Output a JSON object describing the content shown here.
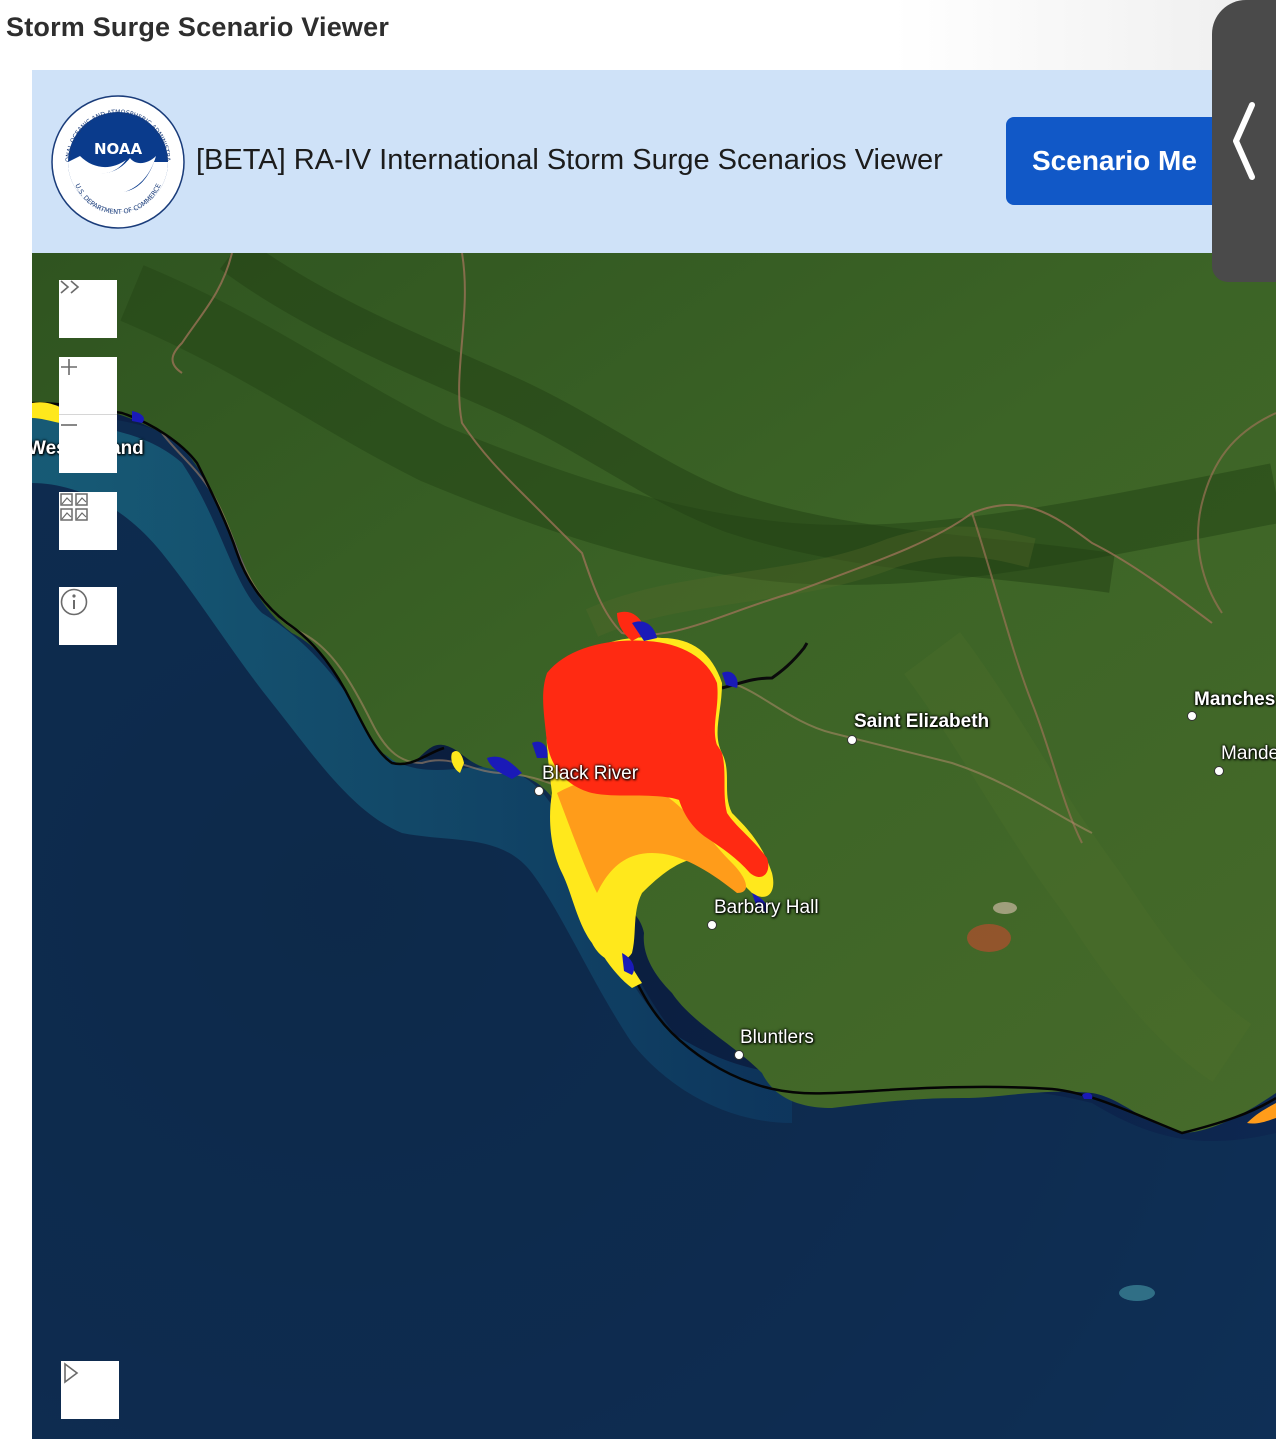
{
  "page": {
    "title": "Storm Surge Scenario Viewer"
  },
  "banner": {
    "logo": {
      "icon": "noaa-logo-icon",
      "center_text": "NOAA",
      "ring_text_top": "NATIONAL OCEANIC AND ATMOSPHERIC ADMINISTRATION",
      "ring_text_bottom": "U.S. DEPARTMENT OF COMMERCE"
    },
    "title": "[BETA] RA-IV International Storm Surge Scenarios Viewer",
    "scenario_button_label": "Scenario Me"
  },
  "map": {
    "controls": {
      "expand": {
        "icon": "double-chevron-right-icon",
        "label": "››"
      },
      "zoom_in": {
        "icon": "plus-icon",
        "label": "+"
      },
      "zoom_out": {
        "icon": "minus-icon",
        "label": "−"
      },
      "basemap": {
        "icon": "basemap-gallery-icon"
      },
      "info": {
        "icon": "info-icon"
      },
      "play": {
        "icon": "play-triangle-icon"
      }
    },
    "labels": {
      "westmoreland": "Wes  land",
      "saint_elizabeth": "Saint Elizabeth",
      "black_river": "Black River",
      "barbary_hall": "Barbary Hall",
      "bluntlers": "Bluntlers",
      "manchester": "Manches",
      "mandeville": "Mande"
    }
  },
  "side_panel": {
    "toggle_icon": "chevron-left-icon",
    "toggle_glyph": "❮"
  },
  "colors": {
    "banner_bg": "#cfe2f8",
    "button_blue": "#1158c7",
    "surge_high": "#ff2a12",
    "surge_mid": "#ff9c1a",
    "surge_low": "#ffe81c",
    "surge_shallow": "#1a1ab8",
    "ocean_deep": "#0f2040",
    "land": "#385e24"
  }
}
